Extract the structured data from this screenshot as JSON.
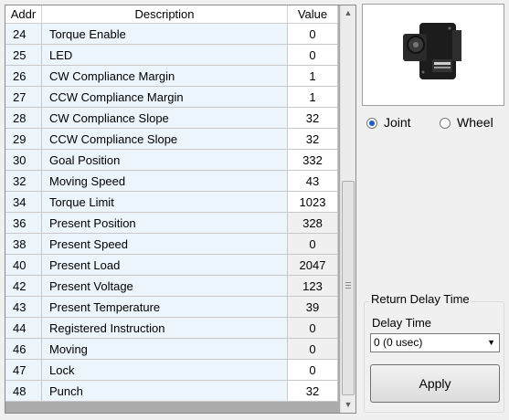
{
  "table": {
    "headers": {
      "addr": "Addr",
      "description": "Description",
      "value": "Value"
    },
    "rows": [
      {
        "addr": "24",
        "description": "Torque Enable",
        "value": "0",
        "readonly": false
      },
      {
        "addr": "25",
        "description": "LED",
        "value": "0",
        "readonly": false
      },
      {
        "addr": "26",
        "description": "CW Compliance Margin",
        "value": "1",
        "readonly": false
      },
      {
        "addr": "27",
        "description": "CCW Compliance Margin",
        "value": "1",
        "readonly": false
      },
      {
        "addr": "28",
        "description": "CW Compliance Slope",
        "value": "32",
        "readonly": false
      },
      {
        "addr": "29",
        "description": "CCW Compliance Slope",
        "value": "32",
        "readonly": false
      },
      {
        "addr": "30",
        "description": "Goal Position",
        "value": "332",
        "readonly": false
      },
      {
        "addr": "32",
        "description": "Moving Speed",
        "value": "43",
        "readonly": false
      },
      {
        "addr": "34",
        "description": "Torque Limit",
        "value": "1023",
        "readonly": false
      },
      {
        "addr": "36",
        "description": "Present Position",
        "value": "328",
        "readonly": true
      },
      {
        "addr": "38",
        "description": "Present Speed",
        "value": "0",
        "readonly": true
      },
      {
        "addr": "40",
        "description": "Present Load",
        "value": "2047",
        "readonly": true
      },
      {
        "addr": "42",
        "description": "Present Voltage",
        "value": "123",
        "readonly": true
      },
      {
        "addr": "43",
        "description": "Present Temperature",
        "value": "39",
        "readonly": true
      },
      {
        "addr": "44",
        "description": "Registered Instruction",
        "value": "0",
        "readonly": true
      },
      {
        "addr": "46",
        "description": "Moving",
        "value": "0",
        "readonly": true
      },
      {
        "addr": "47",
        "description": "Lock",
        "value": "0",
        "readonly": false
      },
      {
        "addr": "48",
        "description": "Punch",
        "value": "32",
        "readonly": false
      }
    ]
  },
  "mode": {
    "options": [
      {
        "label": "Joint",
        "selected": true
      },
      {
        "label": "Wheel",
        "selected": false
      }
    ]
  },
  "return_delay": {
    "title": "Return Delay Time",
    "label": "Delay Time",
    "selected": "0 (0 usec)",
    "apply_label": "Apply"
  },
  "colors": {
    "cell_bg": "#ebf5fb",
    "readonly_value_bg": "#f0f0f0",
    "radio_selected": "#1a5ec8"
  },
  "icons": {
    "servo_image": "servo-motor-image",
    "scroll_up": "chevron-up-icon",
    "scroll_down": "chevron-down-icon"
  }
}
